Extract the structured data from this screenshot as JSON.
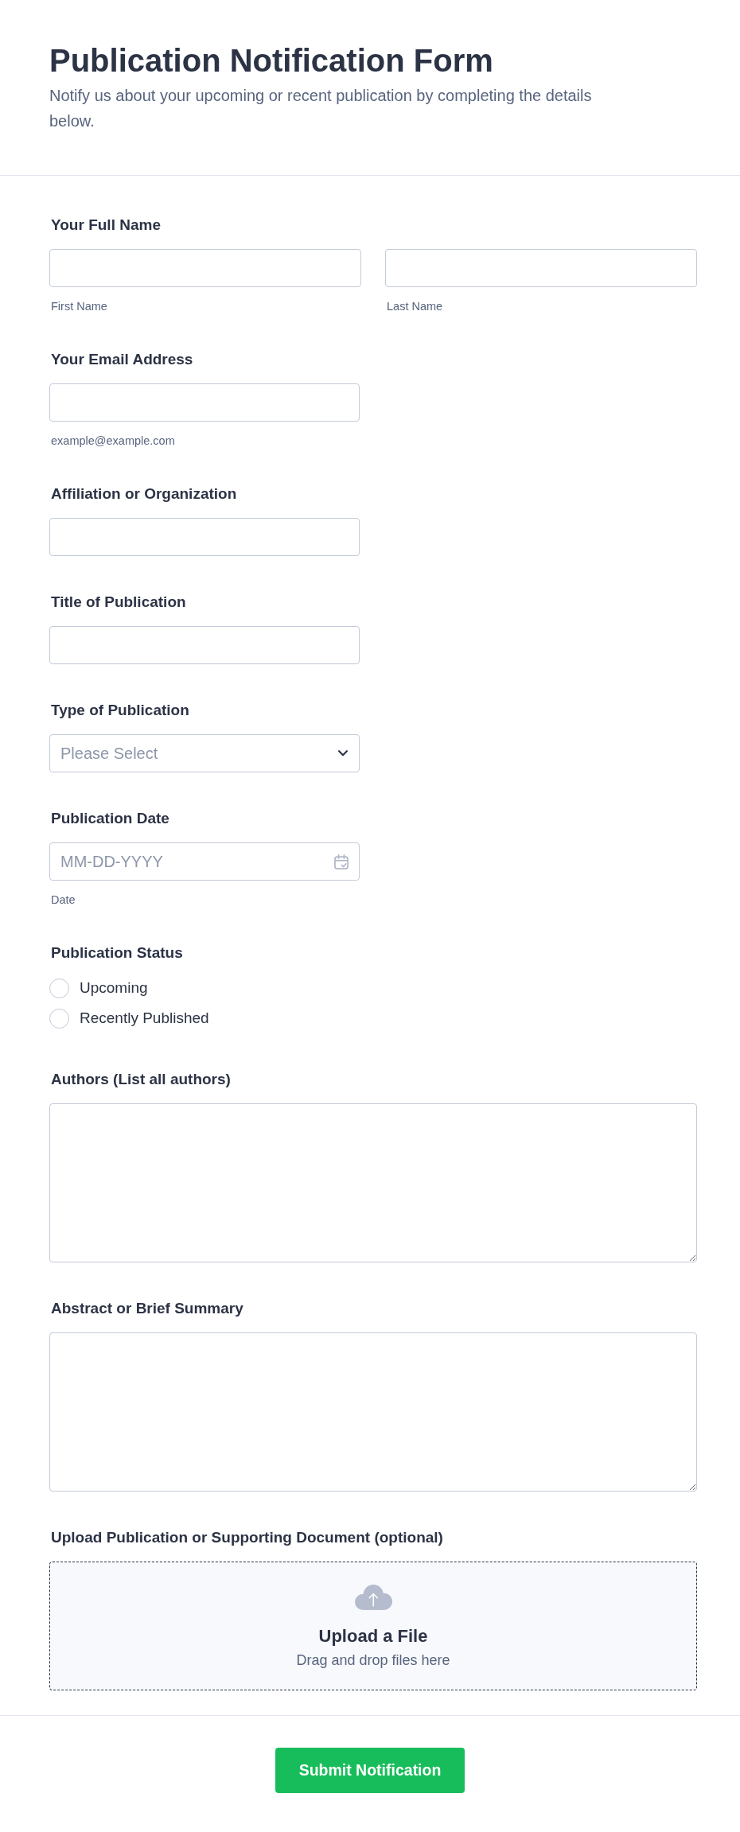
{
  "header": {
    "title": "Publication Notification Form",
    "subtitle": "Notify us about your upcoming or recent publication by completing the details below."
  },
  "fields": [
    {
      "kind": "name",
      "label": "Your Full Name",
      "parts": [
        {
          "sublabel": "First Name"
        },
        {
          "sublabel": "Last Name"
        }
      ]
    },
    {
      "kind": "text",
      "label": "Your Email Address",
      "sublabel": "example@example.com"
    },
    {
      "kind": "text",
      "label": "Affiliation or Organization"
    },
    {
      "kind": "text",
      "label": "Title of Publication"
    },
    {
      "kind": "select",
      "label": "Type of Publication",
      "placeholder": "Please Select"
    },
    {
      "kind": "date",
      "label": "Publication Date",
      "placeholder": "MM-DD-YYYY",
      "sublabel": "Date"
    },
    {
      "kind": "radio",
      "label": "Publication Status",
      "options": [
        {
          "label": "Upcoming",
          "selected": false
        },
        {
          "label": "Recently Published",
          "selected": false
        }
      ]
    },
    {
      "kind": "textarea",
      "label": "Authors (List all authors)"
    },
    {
      "kind": "textarea",
      "label": "Abstract or Brief Summary"
    },
    {
      "kind": "upload",
      "label": "Upload Publication or Supporting Document (optional)",
      "title": "Upload a File",
      "hint": "Drag and drop files here"
    }
  ],
  "submit": {
    "label": "Submit Notification"
  }
}
